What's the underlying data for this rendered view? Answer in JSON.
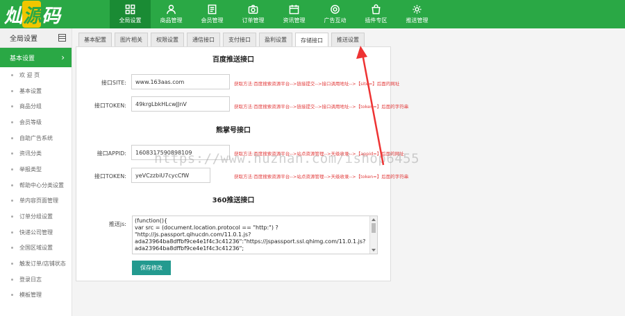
{
  "logo": {
    "left": "灿",
    "mid": "源",
    "right": "码"
  },
  "nav": [
    {
      "label": "全局设置",
      "icon": "grid-icon",
      "active": true
    },
    {
      "label": "商品管理",
      "icon": "user-icon"
    },
    {
      "label": "会员管理",
      "icon": "document-icon"
    },
    {
      "label": "订单管理",
      "icon": "camera-icon"
    },
    {
      "label": "资讯管理",
      "icon": "calendar-icon"
    },
    {
      "label": "广告互动",
      "icon": "gear-icon"
    },
    {
      "label": "插件专区",
      "icon": "bag-icon"
    },
    {
      "label": "推送管理",
      "icon": "gear-icon"
    }
  ],
  "sidebar": {
    "header": "全局设置",
    "active": "基本设置",
    "items": [
      "欢 迎 页",
      "基本设置",
      "商品分组",
      "会员等级",
      "自助广告系统",
      "资讯分类",
      "举报类型",
      "帮助中心分类设置",
      "单内容页面管理",
      "订单分组设置",
      "快递公司管理",
      "全国区域设置",
      "触发订单/店铺状态",
      "登录日志",
      "模板管理"
    ]
  },
  "tabs": [
    "基本配置",
    "图片相关",
    "权限设置",
    "通信接口",
    "支付接口",
    "盈利设置",
    "存储接口",
    "推送设置"
  ],
  "sections": {
    "baidu": {
      "title": "百度推送接口",
      "site_label": "接口SITE:",
      "site_value": "www.163aas.com",
      "site_hint": "获取方法:百度搜索资源平台-->链接提交-->接口调用地址-->【site=】后面的网址",
      "token_label": "接口TOKEN:",
      "token_value": "49krgLbkHLcwJJnV",
      "token_hint": "获取方法:百度搜索资源平台-->链接提交-->接口调用地址-->【token=】后面的字符串"
    },
    "xiongzhang": {
      "title": "熊掌号接口",
      "appid_label": "接口APPID:",
      "appid_value": "1608317590898109",
      "appid_hint": "获取方法:百度搜索资源平台-->站点资源管理-->天级收录-->【appid=】后面的网址",
      "token_label": "接口TOKEN:",
      "token_value": "yeVCzzbiU7cycCfW",
      "token_hint": "获取方法:百度搜索资源平台-->站点资源管理-->天级收录-->【token=】后面的字符串"
    },
    "s360": {
      "title": "360推送接口",
      "js_label": "推送js:",
      "js_lines": [
        "(function(){",
        "var src = (document.location.protocol == \"http:\") ?",
        "\"http://js.passport.qihucdn.com/11.0.1.js?",
        "ada23964ba8dffbf9ce4e1f4c3c41236\":\"https://jspassport.ssl.qhimg.com/11.0.1.js?",
        "ada23964ba8dffbf9ce4e1f4c3c41236\";"
      ]
    }
  },
  "save_label": "保存修改",
  "watermark": "https://www.huzhan.com/ishop6455",
  "colors": {
    "brand": "#2aa845",
    "hint": "#e23b3b",
    "button": "#239a8f"
  }
}
